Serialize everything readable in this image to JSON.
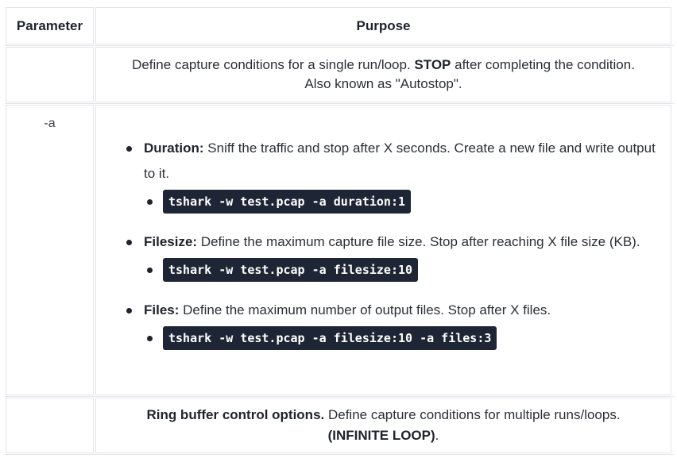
{
  "table": {
    "headers": {
      "parameter": "Parameter",
      "purpose": "Purpose"
    },
    "row1": {
      "parameter": "",
      "purpose_pre": "Define capture conditions for a single run/loop. ",
      "purpose_bold": "STOP",
      "purpose_post": " after completing the condition. Also known as \"Autostop\"."
    },
    "row2": {
      "parameter": "-a",
      "items": [
        {
          "label": "Duration:",
          "text": " Sniff the traffic and stop after X seconds. Create a new file and write output to it.",
          "code": "tshark -w test.pcap -a duration:1"
        },
        {
          "label": "Filesize:",
          "text": " Define the maximum capture file size. Stop after reaching X file size (KB).",
          "code": "tshark -w test.pcap -a filesize:10"
        },
        {
          "label": "Files:",
          "text": " Define the maximum number of output files. Stop after X files.",
          "code": "tshark -w test.pcap -a filesize:10 -a files:3"
        }
      ]
    },
    "row3": {
      "parameter": "",
      "purpose_bold1": "Ring buffer control options.",
      "purpose_mid": " Define capture conditions for multiple runs/loops. ",
      "purpose_bold2": "(INFINITE LOOP)",
      "purpose_post": "."
    }
  },
  "colors": {
    "code_background": "#1e2535",
    "border": "#e3e4e8",
    "text": "#2b2f36"
  }
}
